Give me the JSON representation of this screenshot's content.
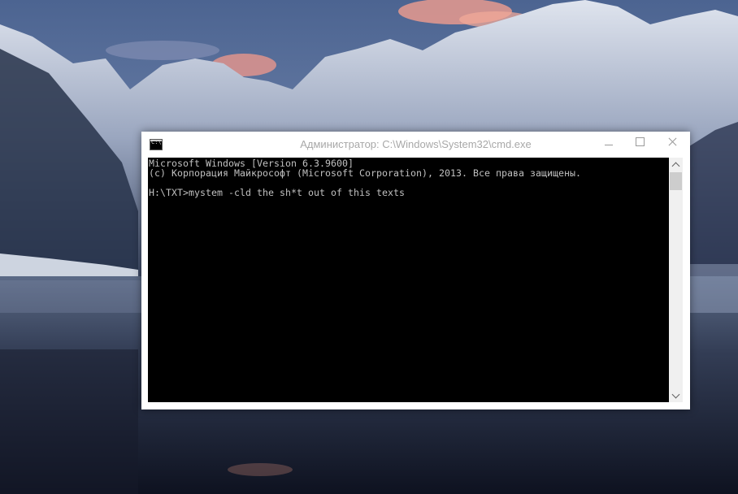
{
  "window": {
    "title": "Администратор: C:\\Windows\\System32\\cmd.exe",
    "icon": "cmd-icon",
    "buttons": {
      "minimize": "minimize-icon",
      "maximize": "maximize-icon",
      "close": "close-icon"
    }
  },
  "console": {
    "lines": [
      "Microsoft Windows [Version 6.3.9600]",
      "(c) Корпорация Майкрософт (Microsoft Corporation), 2013. Все права защищены.",
      "",
      "H:\\TXT>mystem -cld the sh*t out of this texts"
    ],
    "background_color": "#000000",
    "text_color": "#c0c0c0"
  },
  "scrollbar": {
    "up_icon": "chevron-up-icon",
    "down_icon": "chevron-down-icon"
  },
  "desktop": {
    "wallpaper": "snowy-mountain-lake"
  }
}
